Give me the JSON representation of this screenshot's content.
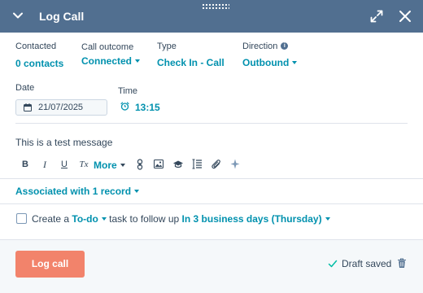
{
  "header": {
    "title": "Log Call",
    "background": "#516f90"
  },
  "fields": {
    "contacted": {
      "label": "Contacted",
      "value": "0 contacts"
    },
    "call_outcome": {
      "label": "Call outcome",
      "value": "Connected"
    },
    "type": {
      "label": "Type",
      "value": "Check In - Call"
    },
    "direction": {
      "label": "Direction",
      "value": "Outbound",
      "info_icon": "i"
    },
    "date": {
      "label": "Date",
      "value": "21/07/2025"
    },
    "time": {
      "label": "Time",
      "value": "13:15"
    }
  },
  "editor": {
    "message": "This is a test message",
    "toolbar": {
      "bold": "B",
      "italic": "I",
      "underline": "U",
      "clear_format": "Tx",
      "more": "More",
      "icons": [
        "bold-icon",
        "italic-icon",
        "underline-icon",
        "clear-format-icon",
        "link-icon",
        "image-icon",
        "knowledge-icon",
        "snippet-icon",
        "attachment-icon",
        "ai-sparkle-icon"
      ]
    }
  },
  "association": {
    "label": "Associated with 1 record"
  },
  "task": {
    "prefix": "Create a",
    "task_type": "To-do",
    "middle": "task to follow up",
    "due": "In 3 business days (Thursday)"
  },
  "footer": {
    "log_button": "Log call",
    "status": "Draft saved"
  },
  "colors": {
    "accent": "#0091ae",
    "primary_button": "#f2836b",
    "text": "#33475b",
    "success": "#00bda5"
  }
}
